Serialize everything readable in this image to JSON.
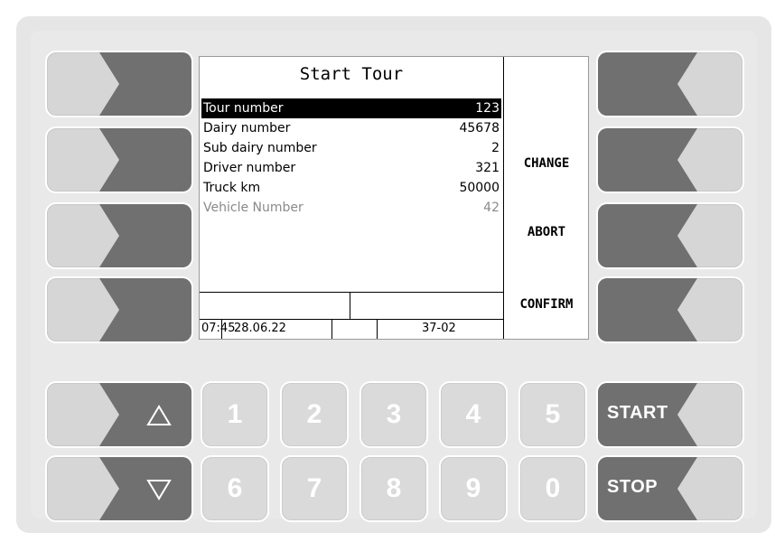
{
  "screen": {
    "title": "Start Tour",
    "rows": [
      {
        "label": "Tour number",
        "value": "123",
        "state": "selected"
      },
      {
        "label": "Dairy number",
        "value": "45678",
        "state": "normal"
      },
      {
        "label": "Sub dairy number",
        "value": "2",
        "state": "normal"
      },
      {
        "label": "Driver number",
        "value": "321",
        "state": "normal"
      },
      {
        "label": "Truck km",
        "value": "50000",
        "state": "normal"
      },
      {
        "label": "Vehicle Number",
        "value": "42",
        "state": "disabled"
      }
    ],
    "softkeys": {
      "right_2": "CHANGE",
      "right_3": "ABORT",
      "right_4": "CONFIRM"
    },
    "status_bar": {
      "time": "07:45",
      "date": "28.06.22",
      "code": "37-02"
    }
  },
  "keypad": {
    "digits_top": [
      "1",
      "2",
      "3",
      "4",
      "5"
    ],
    "digits_bottom": [
      "6",
      "7",
      "8",
      "9",
      "0"
    ],
    "start_label": "START",
    "stop_label": "STOP",
    "up_icon": "triangle-up-icon",
    "down_icon": "triangle-down-icon"
  },
  "colors": {
    "key_dark": "#6f6f6f",
    "key_light": "#d6d6d6",
    "panel": "#e6e6e6"
  }
}
